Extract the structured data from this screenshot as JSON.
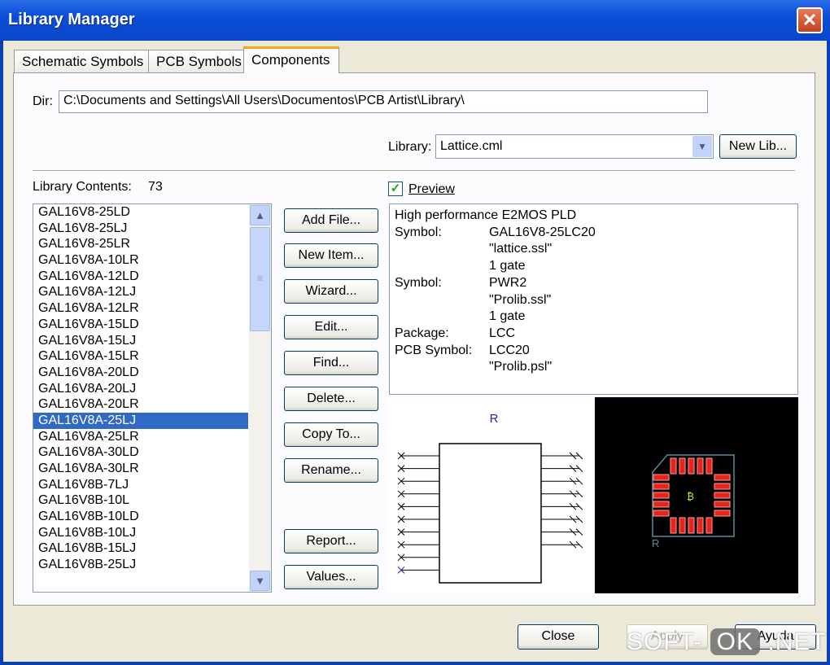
{
  "window": {
    "title": "Library Manager",
    "close_glyph": "✕"
  },
  "tabs": [
    {
      "label": "Schematic Symbols"
    },
    {
      "label": "PCB Symbols"
    },
    {
      "label": "Components",
      "active": true
    }
  ],
  "dir": {
    "label": "Dir:",
    "value": "C:\\Documents and Settings\\All Users\\Documentos\\PCB Artist\\Library\\"
  },
  "library": {
    "label": "Library:",
    "value": "Lattice.cml",
    "new_lib": "New Lib..."
  },
  "contents": {
    "label": "Library Contents:",
    "count": "73",
    "selected": "GAL16V8A-25LJ",
    "items": [
      "GAL16V8-25LD",
      "GAL16V8-25LJ",
      "GAL16V8-25LR",
      "GAL16V8A-10LR",
      "GAL16V8A-12LD",
      "GAL16V8A-12LJ",
      "GAL16V8A-12LR",
      "GAL16V8A-15LD",
      "GAL16V8A-15LJ",
      "GAL16V8A-15LR",
      "GAL16V8A-20LD",
      "GAL16V8A-20LJ",
      "GAL16V8A-20LR",
      "GAL16V8A-25LJ",
      "GAL16V8A-25LR",
      "GAL16V8A-30LD",
      "GAL16V8A-30LR",
      "GAL16V8B-7LJ",
      "GAL16V8B-10L",
      "GAL16V8B-10LD",
      "GAL16V8B-10LJ",
      "GAL16V8B-15LJ",
      "GAL16V8B-25LJ"
    ]
  },
  "actions": [
    "Add File...",
    "New Item...",
    "Wizard...",
    "Edit...",
    "Find...",
    "Delete...",
    "Copy To...",
    "Rename...",
    "Report...",
    "Values..."
  ],
  "preview": {
    "label": "Preview",
    "checked": true,
    "description": "High performance E2MOS PLD",
    "rows": [
      [
        "Symbol:",
        "GAL16V8-25LC20"
      ],
      [
        "",
        "\"lattice.ssl\""
      ],
      [
        "",
        "1 gate"
      ],
      [
        "Symbol:",
        "PWR2"
      ],
      [
        "",
        "\"Prolib.ssl\""
      ],
      [
        "",
        "1 gate"
      ],
      [
        "Package:",
        "LCC"
      ],
      [
        "PCB Symbol:",
        "LCC20"
      ],
      [
        "",
        "\"Prolib.psl\""
      ]
    ],
    "schematic_ref": "R",
    "pcb_ref": "R"
  },
  "footer": {
    "close": "Close",
    "apply": "Apply",
    "help": "Ayuda"
  },
  "watermark": "SOFT-OK.NET",
  "colors": {
    "titlebar": "#0a4fd8",
    "selection": "#316ac5",
    "pad": "#e8231a",
    "outline": "#5a8a96",
    "pcb_bg": "#000000"
  }
}
